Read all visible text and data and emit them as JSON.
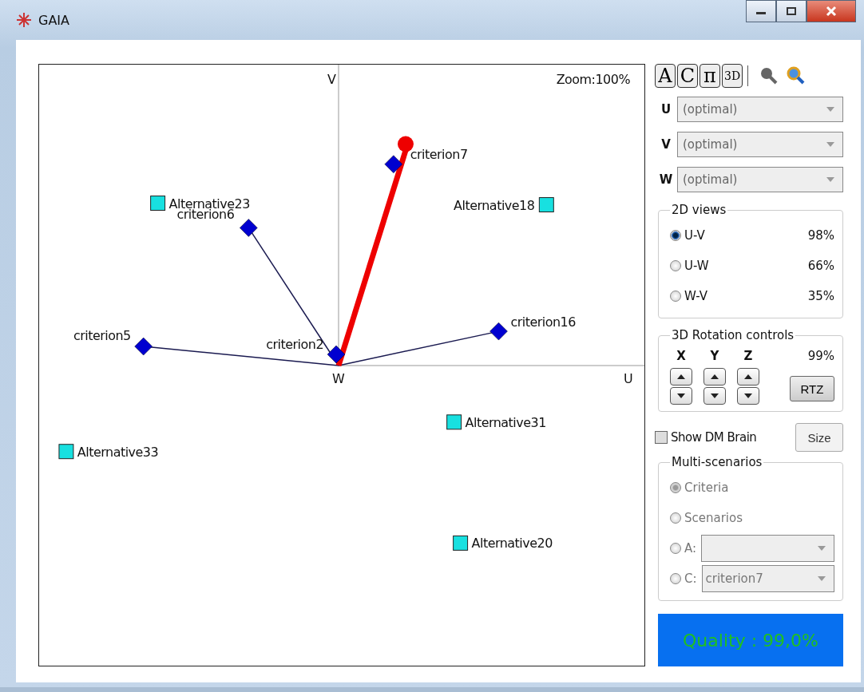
{
  "window": {
    "title": "GAIA"
  },
  "plot": {
    "zoom": "Zoom:100%",
    "axis_labels": {
      "v": "V",
      "w": "W",
      "u": "U"
    },
    "criteria": [
      {
        "label": "criterion7",
        "highlighted": true
      },
      {
        "label": "criterion6",
        "highlighted": false
      },
      {
        "label": "criterion5",
        "highlighted": false
      },
      {
        "label": "criterion2",
        "highlighted": false
      },
      {
        "label": "criterion16",
        "highlighted": false
      }
    ],
    "alternatives": [
      {
        "label": "Alternative23"
      },
      {
        "label": "Alternative18"
      },
      {
        "label": "Alternative31"
      },
      {
        "label": "Alternative33"
      },
      {
        "label": "Alternative20"
      }
    ]
  },
  "toolbar": [
    "A",
    "C",
    "π",
    "3D"
  ],
  "axes": [
    {
      "label": "U",
      "value": "(optimal)"
    },
    {
      "label": "V",
      "value": "(optimal)"
    },
    {
      "label": "W",
      "value": "(optimal)"
    }
  ],
  "views_2d": {
    "title": "2D views",
    "options": [
      {
        "label": "U-V",
        "percent": "98%",
        "selected": true
      },
      {
        "label": "U-W",
        "percent": "66%",
        "selected": false
      },
      {
        "label": "W-V",
        "percent": "35%",
        "selected": false
      }
    ]
  },
  "rotation": {
    "title": "3D Rotation controls",
    "axes": [
      "X",
      "Y",
      "Z"
    ],
    "percent": "99%",
    "button": "RTZ"
  },
  "show_dm_brain": {
    "label": "Show DM Brain",
    "checked": false
  },
  "size_button": "Size",
  "multi_scenarios": {
    "title": "Multi-scenarios",
    "disabled": true,
    "options": [
      {
        "kind": "radio",
        "label": "Criteria",
        "selected": true
      },
      {
        "kind": "radio",
        "label": "Scenarios",
        "selected": false
      },
      {
        "kind": "select",
        "label": "A:",
        "selected": false
      },
      {
        "kind": "select",
        "label": "C:",
        "value": "criterion7",
        "selected": false
      }
    ]
  },
  "quality": "Quality : 99,0%"
}
